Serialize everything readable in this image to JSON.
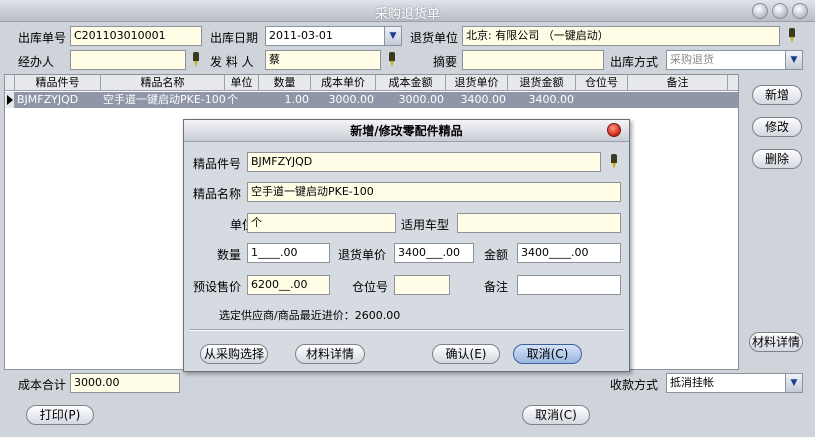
{
  "window": {
    "title": "采购退货单"
  },
  "form": {
    "order_no_label": "出库单号",
    "order_no": "C201103010001",
    "date_label": "出库日期",
    "date": "2011-03-01",
    "return_unit_label": "退货单位",
    "return_unit": "北京:                 有限公司 （一键启动）",
    "handler_label": "经办人",
    "handler": "",
    "issuer_label": "发 料 人",
    "issuer": "蔡",
    "summary_label": "摘要",
    "summary": "",
    "method_label": "出库方式",
    "method": "采购退货"
  },
  "grid": {
    "headers": [
      "精品件号",
      "精品名称",
      "单位",
      "数量",
      "成本单价",
      "成本金额",
      "退货单价",
      "退货金额",
      "仓位号",
      "备注"
    ],
    "rows": [
      [
        "BJMFZYJQD",
        "空手道一键启动PKE-100",
        "个",
        "1.00",
        "3000.00",
        "3000.00",
        "3400.00",
        "3400.00",
        "",
        ""
      ]
    ]
  },
  "side_buttons": {
    "add": "新增",
    "edit": "修改",
    "delete": "删除",
    "detail": "材料详情"
  },
  "footer": {
    "cost_total_label": "成本合计",
    "cost_total": "3000.00",
    "payment_label": "收款方式",
    "payment": "抵消挂帐",
    "print": "打印(P)",
    "cancel": "取消(C)"
  },
  "dialog": {
    "title": "新增/修改零配件精品",
    "part_no_label": "精品件号",
    "part_no": "BJMFZYJQD",
    "name_label": "精品名称",
    "name": "空手道一键启动PKE-100",
    "unit_label": "单位",
    "unit": "个",
    "model_label": "适用车型",
    "model": "",
    "qty_label": "数量",
    "qty": "1____.00",
    "return_price_label": "退货单价",
    "return_price": "3400___.00",
    "amount_label": "金额",
    "amount": "3400____.00",
    "preset_price_label": "预设售价",
    "preset_price": "6200__.00",
    "location_label": "仓位号",
    "location": "",
    "remark_label": "备注",
    "remark": "",
    "recent_price_text": "选定供应商/商品最近进价：2600.00",
    "from_purchase": "从采购选择",
    "detail": "材料详情",
    "ok": "确认(E)",
    "cancel": "取消(C)"
  }
}
